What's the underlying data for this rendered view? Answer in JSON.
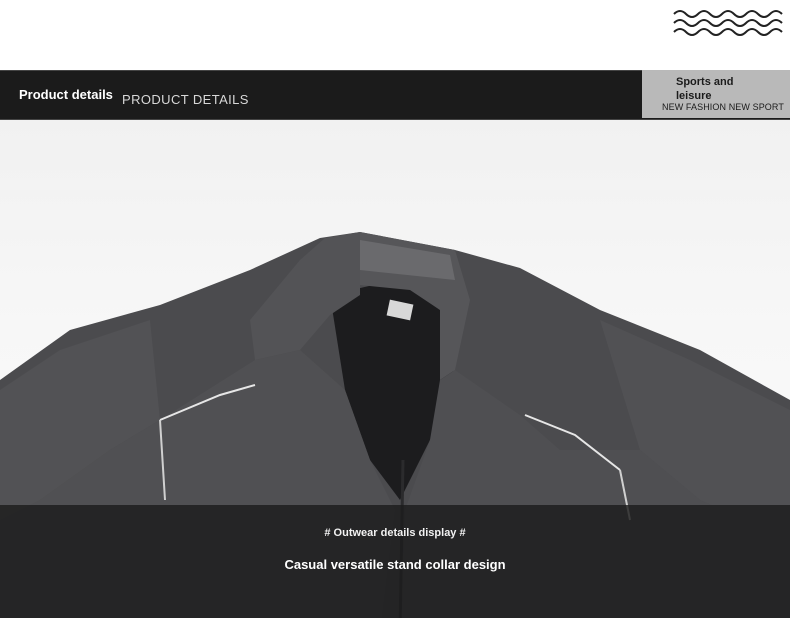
{
  "header": {
    "title": "Product details",
    "subtitle": "PRODUCT DETAILS"
  },
  "sport_box": {
    "title": "Sports and leisure",
    "subtitle": "NEW FASHION  NEW SPORT"
  },
  "caption": {
    "line1": "# Outwear details display #",
    "line2": "Casual versatile stand collar design"
  },
  "decor": {
    "wave_icon": "wave-lines-icon"
  },
  "colors": {
    "header_bg": "#1b1b1b",
    "sport_box_bg": "#b9b9b9",
    "jacket": "#4a4a4c"
  }
}
